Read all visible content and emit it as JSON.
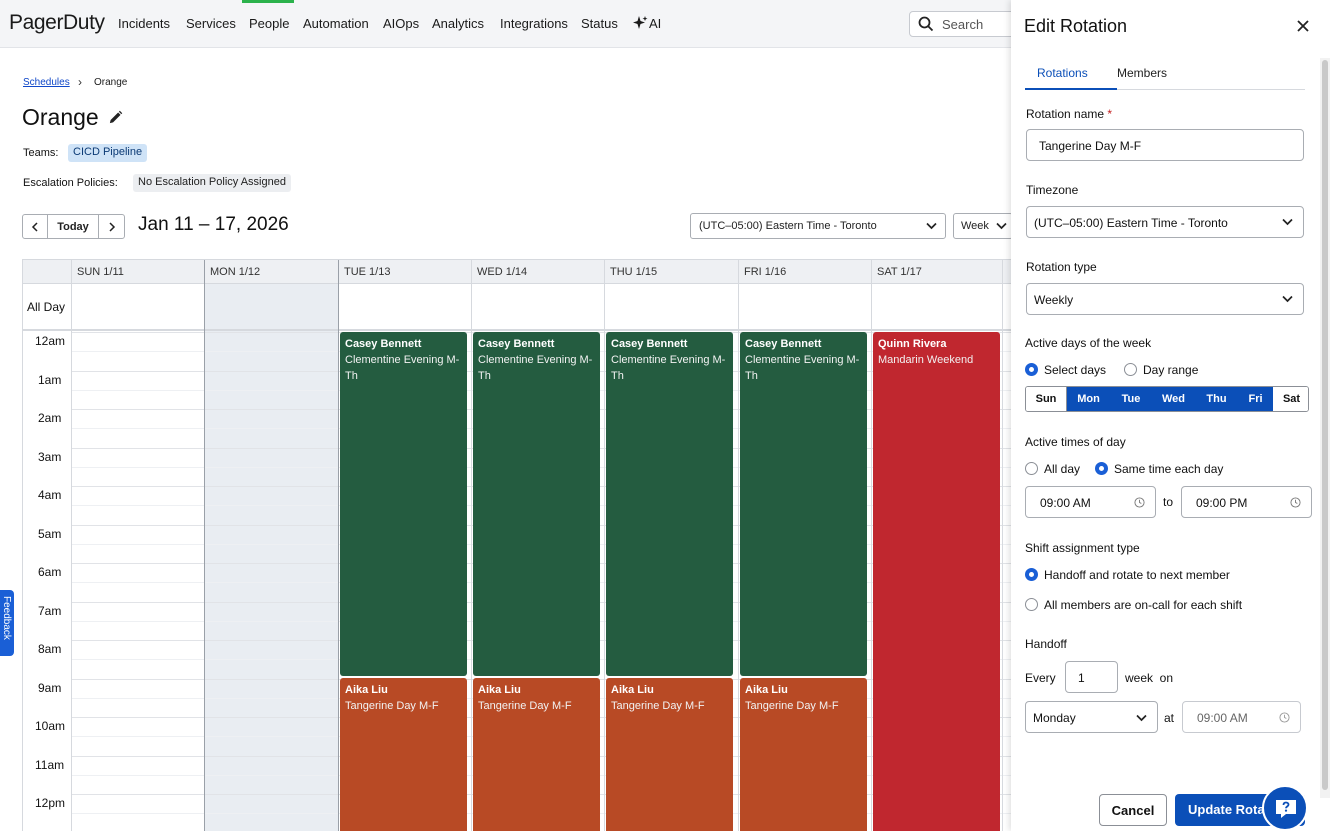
{
  "nav": {
    "logo": "PagerDuty",
    "items": [
      "Incidents",
      "Services",
      "People",
      "Automation",
      "AIOps",
      "Analytics",
      "Integrations",
      "Status",
      "AI"
    ],
    "search_placeholder": "Search",
    "active_color": "#2bb24c"
  },
  "breadcrumb": {
    "parent": "Schedules",
    "current": "Orange"
  },
  "schedule": {
    "title": "Orange",
    "teams_label": "Teams:",
    "team": "CICD Pipeline",
    "esc_label": "Escalation Policies:",
    "esc_value": "No Escalation Policy Assigned"
  },
  "calendar": {
    "today_label": "Today",
    "range": "Jan 11 – 17, 2026",
    "timezone": "(UTC–05:00) Eastern Time - Toronto",
    "view": "Week",
    "allday_label": "All Day",
    "columns": [
      "SUN 1/11",
      "MON 1/12",
      "TUE 1/13",
      "WED 1/14",
      "THU 1/15",
      "FRI 1/16",
      "SAT 1/17"
    ],
    "hours": [
      "12am",
      "1am",
      "2am",
      "3am",
      "4am",
      "5am",
      "6am",
      "7am",
      "8am",
      "9am",
      "10am",
      "11am",
      "12pm"
    ],
    "shifts": {
      "evening_person": "Casey Bennett",
      "evening_rotation": "Clementine Evening M-Th",
      "day_person": "Aika Liu",
      "day_rotation": "Tangerine Day M-F",
      "weekend_person": "Quinn Rivera",
      "weekend_rotation": "Mandarin Weekend"
    },
    "colors": {
      "evening": "#245c40",
      "day": "#b84a25",
      "weekend": "#c0272f"
    }
  },
  "feedback_label": "Feedback",
  "panel": {
    "title": "Edit Rotation",
    "tabs": [
      "Rotations",
      "Members"
    ],
    "rotation_name_label": "Rotation name",
    "required_mark": "*",
    "rotation_name": "Tangerine Day M-F",
    "timezone_label": "Timezone",
    "timezone": "(UTC–05:00) Eastern Time - Toronto",
    "rotation_type_label": "Rotation type",
    "rotation_type": "Weekly",
    "active_days_label": "Active days of the week",
    "select_days": "Select days",
    "day_range": "Day range",
    "days": [
      {
        "label": "Sun",
        "on": false
      },
      {
        "label": "Mon",
        "on": true
      },
      {
        "label": "Tue",
        "on": true
      },
      {
        "label": "Wed",
        "on": true
      },
      {
        "label": "Thu",
        "on": true
      },
      {
        "label": "Fri",
        "on": true
      },
      {
        "label": "Sat",
        "on": false
      }
    ],
    "active_times_label": "Active times of day",
    "all_day": "All day",
    "same_time": "Same time each day",
    "start_time": "09:00 AM",
    "to_label": "to",
    "end_time": "09:00 PM",
    "shift_type_label": "Shift assignment type",
    "handoff_rotate": "Handoff and rotate to next member",
    "all_members": "All members are on-call for each shift",
    "handoff_label": "Handoff",
    "every_label": "Every",
    "every_value": "1",
    "week_on_label": "week  on",
    "handoff_day": "Monday",
    "at_label": "at",
    "handoff_time": "09:00 AM",
    "cancel": "Cancel",
    "update": "Update Rotation"
  }
}
